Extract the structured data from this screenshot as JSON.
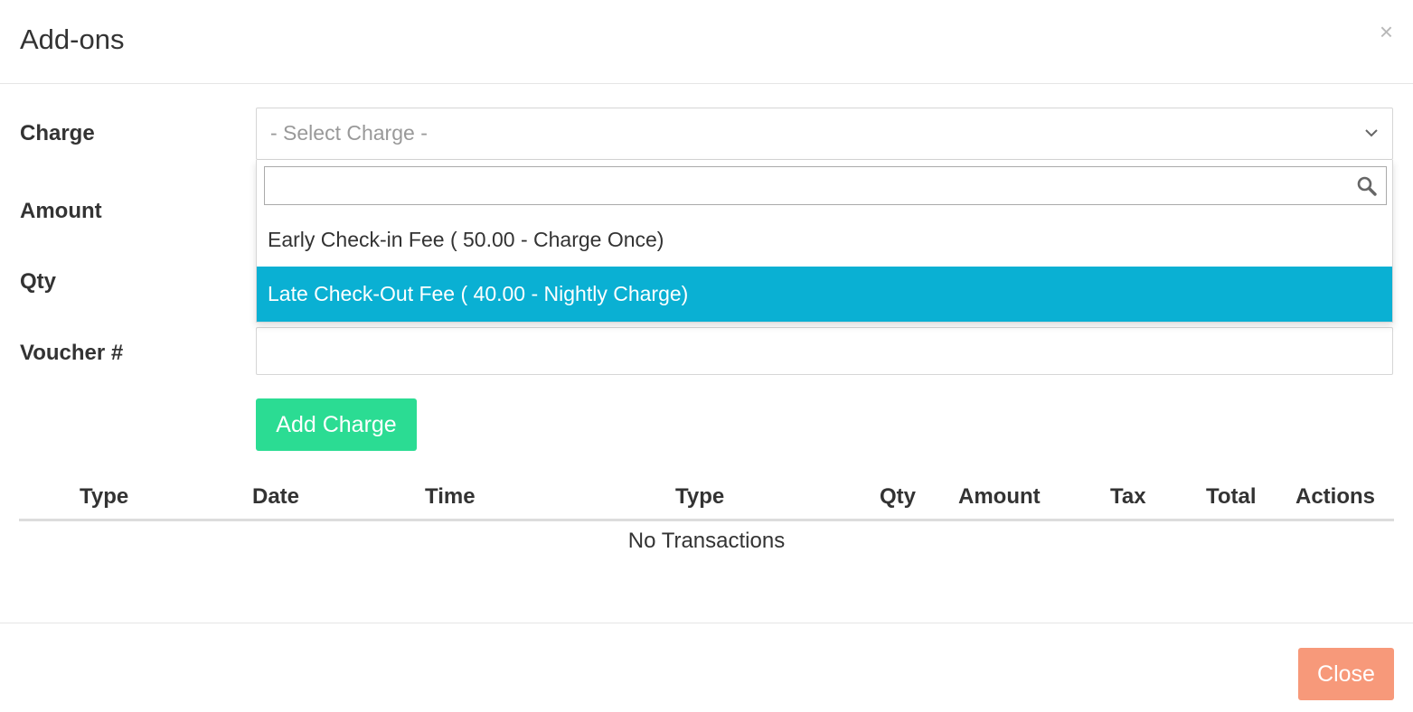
{
  "modal": {
    "title": "Add-ons",
    "close_glyph": "×"
  },
  "form": {
    "charge_label": "Charge",
    "amount_label": "Amount",
    "qty_label": "Qty",
    "voucher_label": "Voucher #",
    "charge_select": {
      "placeholder": "- Select Charge -",
      "search_value": "",
      "options": [
        {
          "label": "Early Check-in Fee ( 50.00 - Charge Once)",
          "highlighted": false
        },
        {
          "label": "Late Check-Out Fee ( 40.00 - Nightly Charge)",
          "highlighted": true
        }
      ]
    },
    "voucher_value": "",
    "add_button_label": "Add Charge"
  },
  "table": {
    "columns": [
      "Type",
      "Date",
      "Time",
      "Type",
      "Qty",
      "Amount",
      "Tax",
      "Total",
      "Actions"
    ],
    "empty_message": "No Transactions"
  },
  "footer": {
    "close_label": "Close"
  },
  "colors": {
    "highlight": "#0ab0d3",
    "add_button": "#2bdc93",
    "close_button": "#f7997a"
  },
  "icons": {
    "dropdown": "chevron-down-icon",
    "search": "search-icon",
    "close": "close-icon"
  }
}
